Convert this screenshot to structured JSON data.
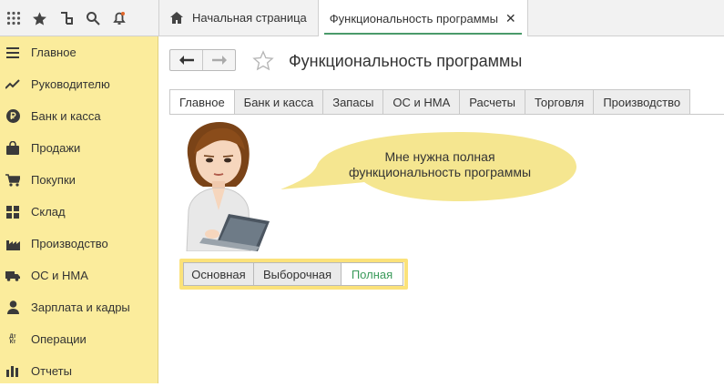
{
  "topbar": {
    "icons": [
      "apps-grid-icon",
      "favorites-star-icon",
      "history-icon",
      "search-icon",
      "notifications-bell-icon"
    ],
    "tabs": [
      {
        "label": "Начальная страница",
        "icon": "home-icon"
      },
      {
        "label": "Функциональность программы",
        "close": "✕"
      }
    ]
  },
  "sidebar": {
    "items": [
      {
        "label": "Главное",
        "icon": "menu-lines-icon"
      },
      {
        "label": "Руководителю",
        "icon": "trend-chart-icon"
      },
      {
        "label": "Банк и касса",
        "icon": "ruble-coin-icon"
      },
      {
        "label": "Продажи",
        "icon": "shopping-bag-icon"
      },
      {
        "label": "Покупки",
        "icon": "shopping-cart-icon"
      },
      {
        "label": "Склад",
        "icon": "warehouse-grid-icon"
      },
      {
        "label": "Производство",
        "icon": "factory-icon"
      },
      {
        "label": "ОС и НМА",
        "icon": "truck-icon"
      },
      {
        "label": "Зарплата и кадры",
        "icon": "person-icon"
      },
      {
        "label": "Операции",
        "icon": "dt-kt-icon",
        "icon_text": "Дт Кт"
      },
      {
        "label": "Отчеты",
        "icon": "bar-chart-icon"
      }
    ]
  },
  "main": {
    "title": "Функциональность программы",
    "tabs": [
      "Главное",
      "Банк и касса",
      "Запасы",
      "ОС и НМА",
      "Расчеты",
      "Торговля",
      "Производство"
    ],
    "active_tab": "Главное",
    "bubble_text_line1": "Мне нужна полная",
    "bubble_text_line2": "функциональность программы",
    "selector": {
      "options": [
        "Основная",
        "Выборочная",
        "Полная"
      ],
      "selected": "Полная"
    }
  },
  "colors": {
    "sidebar_bg": "#fbec9c",
    "selector_frame": "#fbe27a",
    "bubble": "#f5e690",
    "selected_text": "#3a9a5a"
  }
}
